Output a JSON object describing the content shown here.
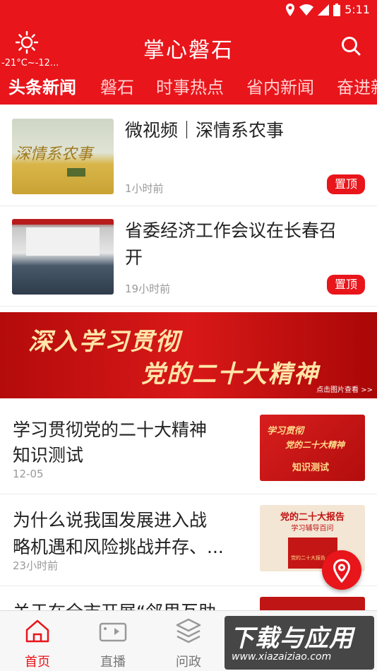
{
  "status_bar": {
    "time": "5:11",
    "icons": [
      "location-icon",
      "wifi-icon",
      "signal-icon",
      "battery-icon"
    ]
  },
  "header": {
    "weather_temp": "-21°C~-12...",
    "title": "掌心磐石"
  },
  "tabs": [
    {
      "label": "头条新闻",
      "active": true
    },
    {
      "label": "磐石"
    },
    {
      "label": "时事热点"
    },
    {
      "label": "省内新闻"
    },
    {
      "label": "奋进新"
    }
  ],
  "news": [
    {
      "title": "微视频｜深情系农事",
      "time": "1小时前",
      "badge": "置顶",
      "thumb_text": "深情系农事"
    },
    {
      "title_line1": "省委经济工作会议在长春召",
      "title_line2": "开",
      "time": "19小时前",
      "badge": "置顶"
    },
    {
      "title_line1": "学习贯彻党的二十大精神",
      "title_line2": "知识测试",
      "time": "12-05",
      "thumb_lines": [
        "学习贯彻",
        "党的二十大精神",
        "知识测试"
      ]
    },
    {
      "title_line1": "为什么说我国发展进入战",
      "title_line2": "略机遇和风险挑战并存、...",
      "time": "23小时前",
      "thumb_lines": [
        "党的二十大报告",
        "学习辅导百问",
        "党的二十大报告"
      ]
    },
    {
      "title_line1": "关于在全市开展“邻里互助"
    }
  ],
  "banner": {
    "line1": "深入学习贯彻",
    "line2": "党的二十大精神",
    "hint": "点击图片查看 >>"
  },
  "bottom_nav": [
    {
      "label": "首页",
      "icon": "home-icon",
      "active": true
    },
    {
      "label": "直播",
      "icon": "video-camera-icon"
    },
    {
      "label": "问政",
      "icon": "layers-icon"
    }
  ],
  "watermark": {
    "main": "下载与应用",
    "sub": "www.xiazaiziao.com"
  },
  "colors": {
    "brand_red": "#e8151b",
    "inactive_tab": "#ffd0d0",
    "muted_text": "#999999"
  }
}
